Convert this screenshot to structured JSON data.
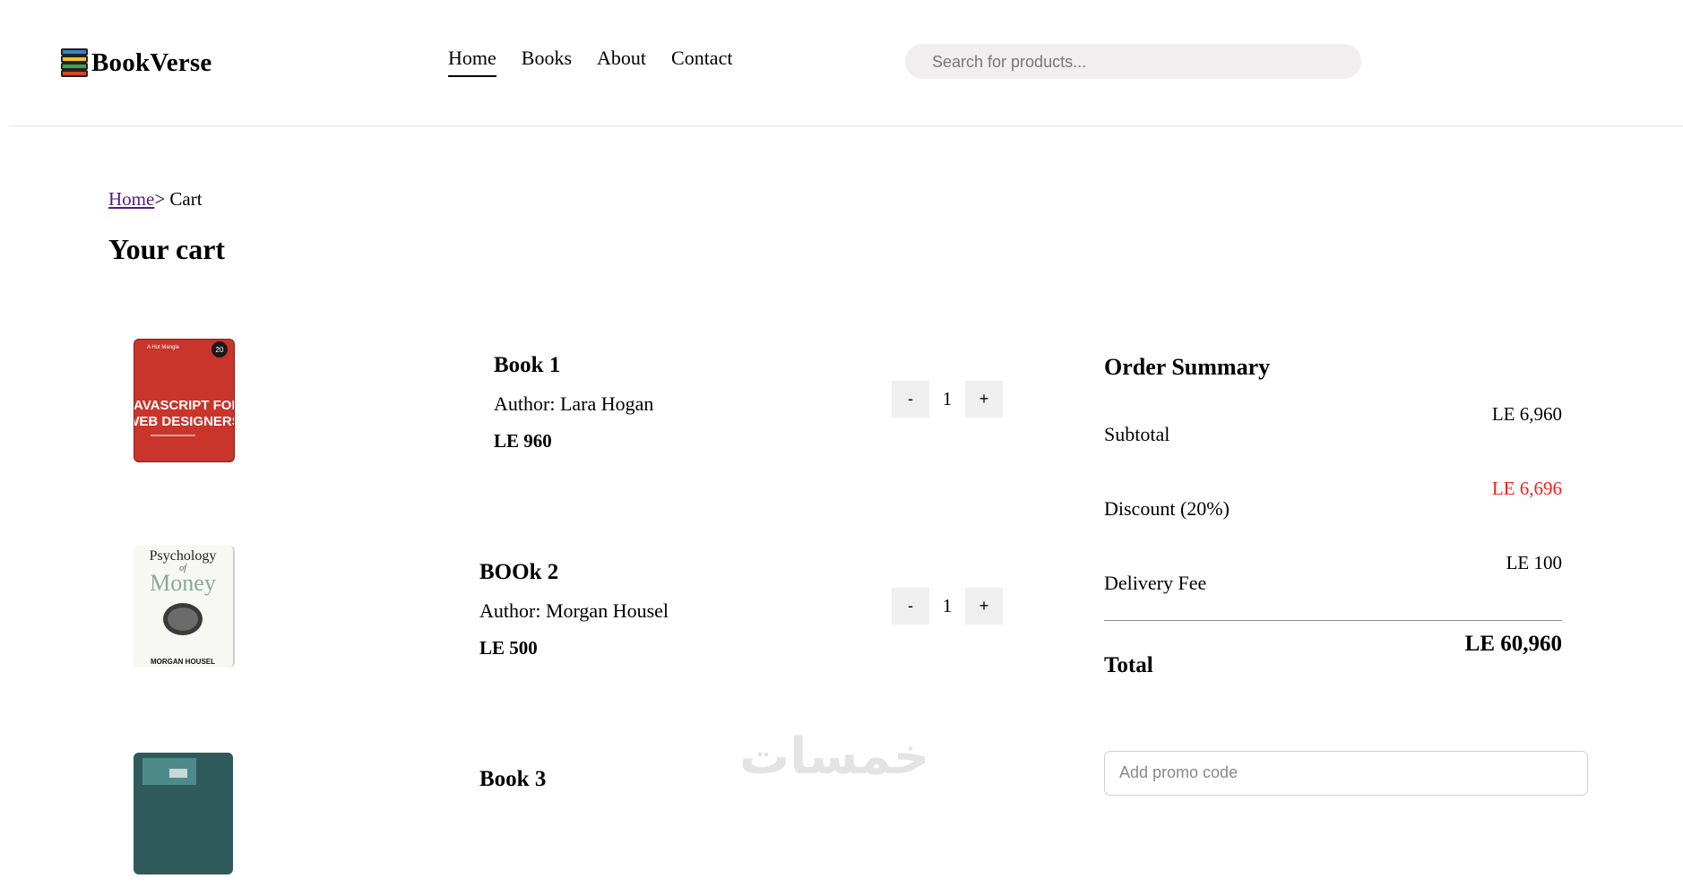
{
  "brand": {
    "name": "BookVerse",
    "icon": "books-stack-icon"
  },
  "nav": {
    "items": [
      {
        "label": "Home",
        "active": true
      },
      {
        "label": "Books",
        "active": false
      },
      {
        "label": "About",
        "active": false
      },
      {
        "label": "Contact",
        "active": false
      }
    ]
  },
  "search": {
    "placeholder": "Search for products..."
  },
  "breadcrumb": {
    "home": "Home",
    "separator": "> ",
    "current": "Cart"
  },
  "page": {
    "title": "Your cart"
  },
  "cart": {
    "items": [
      {
        "title": "Book 1",
        "author": "Author: Lara Hogan",
        "price": "LE 960",
        "quantity": "1",
        "cover": {
          "top": "A Hot Mangle",
          "badge": "20",
          "title_line1": "JAVASCRIPT FOR",
          "title_line2": "WEB DESIGNERS"
        }
      },
      {
        "title": "BOOk 2",
        "author": "Author: Morgan Housel",
        "price": "LE 500",
        "quantity": "1",
        "cover": {
          "title_line1": "Psychology",
          "title_line2": "of",
          "title_line3": "Money",
          "author": "MORGAN HOUSEL"
        }
      },
      {
        "title": "Book 3"
      }
    ],
    "minus_label": "-",
    "plus_label": "+"
  },
  "summary": {
    "title": "Order Summary",
    "subtotal_label": "Subtotal",
    "subtotal_value": "LE 6,960",
    "discount_label": "Discount (20%)",
    "discount_value": "LE 6,696",
    "delivery_label": "Delivery Fee",
    "delivery_value": "LE 100",
    "total_label": "Total",
    "total_value": "LE 60,960",
    "discount_color": "#ff1a1a"
  },
  "promo": {
    "placeholder": "Add promo code"
  },
  "watermark": "خمسات"
}
